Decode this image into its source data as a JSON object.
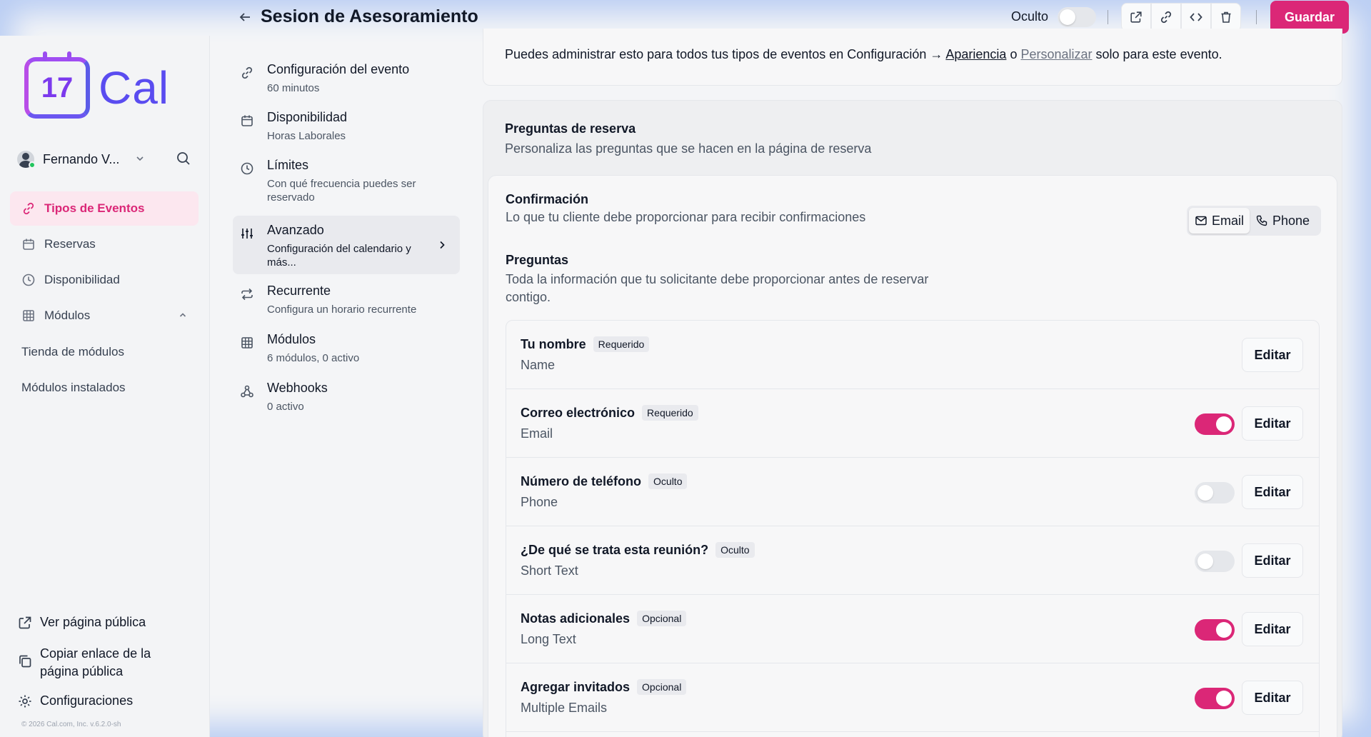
{
  "app": {
    "logo_badge": "17",
    "logo_text": "Cal",
    "accent_color": "#db2777"
  },
  "sidebar": {
    "user_name": "Fernando V...",
    "items": [
      {
        "label": "Tipos de Eventos",
        "icon": "link-icon",
        "active": true
      },
      {
        "label": "Reservas",
        "icon": "calendar-icon",
        "active": false
      },
      {
        "label": "Disponibilidad",
        "icon": "clock-icon",
        "active": false
      },
      {
        "label": "Módulos",
        "icon": "grid-icon",
        "active": false
      }
    ],
    "sub_items": [
      "Tienda de módulos",
      "Módulos instalados"
    ],
    "bottom": {
      "view_public": "Ver página pública",
      "copy_link": "Copiar enlace de la página pública",
      "settings": "Configuraciones"
    },
    "copyright": "© 2026 Cal.com, Inc. v.6.2.0-sh"
  },
  "header": {
    "title": "Sesion de Asesoramiento",
    "hidden_label": "Oculto",
    "save_label": "Guardar"
  },
  "menu": [
    {
      "title": "Configuración del evento",
      "sub": "60 minutos"
    },
    {
      "title": "Disponibilidad",
      "sub": "Horas Laborales"
    },
    {
      "title": "Límites",
      "sub": "Con qué frecuencia puedes ser reservado"
    },
    {
      "title": "Avanzado",
      "sub": "Configuración del calendario y más..."
    },
    {
      "title": "Recurrente",
      "sub": "Configura un horario recurrente"
    },
    {
      "title": "Módulos",
      "sub": "6 módulos, 0 activo"
    },
    {
      "title": "Webhooks",
      "sub": "0 activo"
    }
  ],
  "appearance_note": {
    "prefix": "Puedes administrar esto para todos tus tipos de eventos en Configuración → ",
    "link1": "Apariencia",
    "middle": " o ",
    "link2": "Personalizar",
    "suffix": " solo para este evento."
  },
  "booking": {
    "title": "Preguntas de reserva",
    "subtitle": "Personaliza las preguntas que se hacen en la página de reserva",
    "confirmation_title": "Confirmación",
    "confirmation_sub": "Lo que tu cliente debe proporcionar para recibir confirmaciones",
    "seg_email": "Email",
    "seg_phone": "Phone",
    "questions_title": "Preguntas",
    "questions_sub": "Toda la información que tu solicitante debe proporcionar antes de reservar contigo.",
    "edit_label": "Editar",
    "questions": [
      {
        "name": "Tu nombre",
        "badge": "Requerido",
        "type": "Name",
        "toggle": null
      },
      {
        "name": "Correo electrónico",
        "badge": "Requerido",
        "type": "Email",
        "toggle": true
      },
      {
        "name": "Número de teléfono",
        "badge": "Oculto",
        "type": "Phone",
        "toggle": false
      },
      {
        "name": "¿De qué se trata esta reunión?",
        "badge": "Oculto",
        "type": "Short Text",
        "toggle": false
      },
      {
        "name": "Notas adicionales",
        "badge": "Opcional",
        "type": "Long Text",
        "toggle": true
      },
      {
        "name": "Agregar invitados",
        "badge": "Opcional",
        "type": "Multiple Emails",
        "toggle": true
      }
    ]
  }
}
